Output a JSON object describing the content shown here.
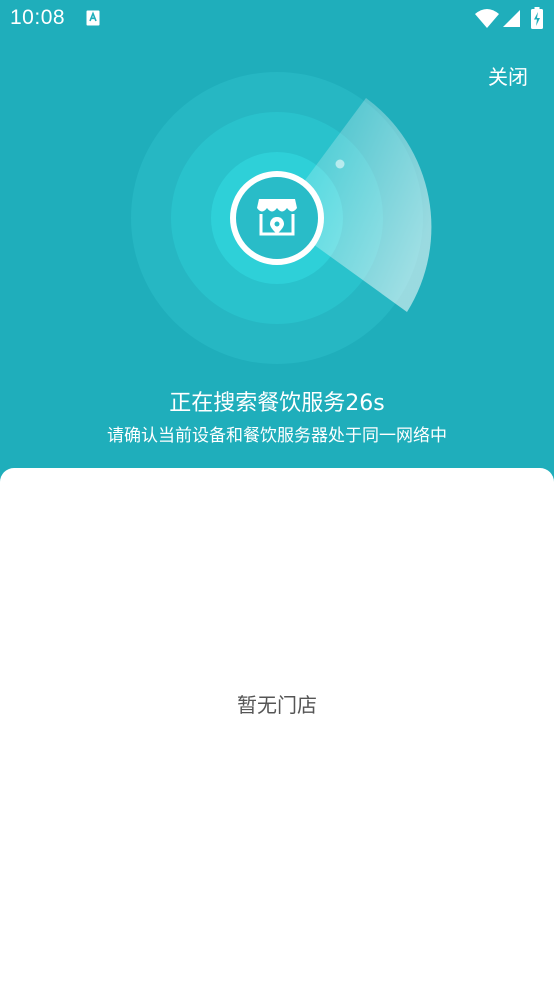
{
  "status_bar": {
    "time": "10:08",
    "icons": [
      "app-notification-icon",
      "wifi-icon",
      "signal-icon",
      "battery-charging-icon"
    ]
  },
  "header": {
    "close_label": "关闭"
  },
  "radar": {
    "icon": "store-location-icon",
    "colors": {
      "background": "#1faebb",
      "ring": "#29c2cc",
      "center": "#2ed0d8"
    }
  },
  "search": {
    "title": "正在搜索餐饮服务26s",
    "subtitle": "请确认当前设备和餐饮服务器处于同一网络中"
  },
  "content": {
    "empty_text": "暂无门店"
  }
}
